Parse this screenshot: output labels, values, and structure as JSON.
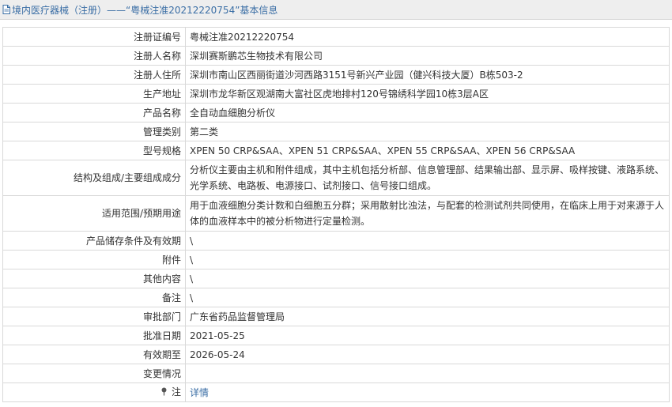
{
  "header": {
    "breadcrumb_text": "境内医疗器械（注册）——“粤械注准20212220754”基本信息",
    "icon": "document-icon"
  },
  "rows": [
    {
      "label": "注册证编号",
      "value": "粤械注准20212220754"
    },
    {
      "label": "注册人名称",
      "value": "深圳赛斯鹏芯生物技术有限公司"
    },
    {
      "label": "注册人住所",
      "value": "深圳市南山区西丽街道沙河西路3151号新兴产业园（健兴科技大厦）B栋503-2"
    },
    {
      "label": "生产地址",
      "value": "深圳市龙华新区观湖南大富社区虎地排村120号锦绣科学园10栋3层A区"
    },
    {
      "label": "产品名称",
      "value": "全自动血细胞分析仪"
    },
    {
      "label": "管理类别",
      "value": "第二类"
    },
    {
      "label": "型号规格",
      "value": "XPEN 50 CRP&SAA、XPEN 51 CRP&SAA、XPEN 55 CRP&SAA、XPEN 56 CRP&SAA"
    },
    {
      "label": "结构及组成/主要组成成分",
      "value": "分析仪主要由主机和附件组成，其中主机包括分析部、信息管理部、结果输出部、显示屏、吸样按键、液路系统、光学系统、电路板、电源接口、试剂接口、信号接口组成。"
    },
    {
      "label": "适用范围/预期用途",
      "value": "用于血液细胞分类计数和白细胞五分群；采用散射比浊法，与配套的检测试剂共同使用，在临床上用于对来源于人体的血液样本中的被分析物进行定量检测。"
    },
    {
      "label": "产品储存条件及有效期",
      "value": "\\"
    },
    {
      "label": "附件",
      "value": "\\"
    },
    {
      "label": "其他内容",
      "value": "\\"
    },
    {
      "label": "备注",
      "value": "\\"
    },
    {
      "label": "审批部门",
      "value": "广东省药品监督管理局"
    },
    {
      "label": "批准日期",
      "value": "2021-05-25"
    },
    {
      "label": "有效期至",
      "value": "2026-05-24"
    },
    {
      "label": "变更情况",
      "value": ""
    }
  ],
  "note_row": {
    "pin_icon": "pin-icon",
    "label": "注",
    "link_text": "详情"
  }
}
